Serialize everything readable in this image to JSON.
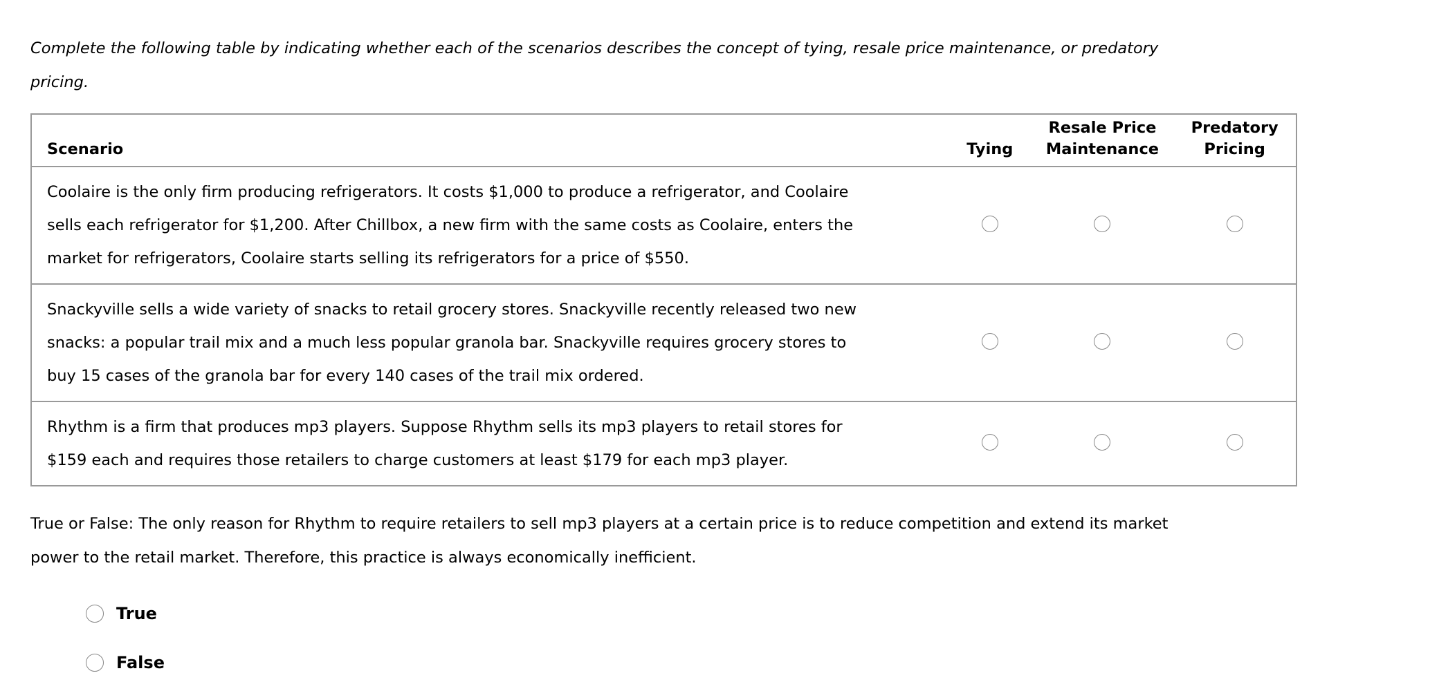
{
  "instructions": {
    "lines": [
      "Complete the following table by indicating whether each of the scenarios describes the concept of tying, resale price maintenance, or predatory",
      "pricing."
    ]
  },
  "table": {
    "headers": {
      "scenario": "Scenario",
      "tying": "Tying",
      "rpm_line1": "Resale Price",
      "rpm_line2": "Maintenance",
      "pred_line1": "Predatory",
      "pred_line2": "Pricing"
    },
    "rows": [
      {
        "lines": [
          "Coolaire is the only firm producing refrigerators. It costs $1,000 to produce a refrigerator, and Coolaire",
          "sells each refrigerator for $1,200. After Chillbox, a new firm with the same costs as Coolaire, enters the",
          "market for refrigerators, Coolaire starts selling its refrigerators for a price of $550."
        ],
        "selected": null
      },
      {
        "lines": [
          "Snackyville sells a wide variety of snacks to retail grocery stores. Snackyville recently released two new",
          "snacks: a popular trail mix and a much less popular granola bar. Snackyville requires grocery stores to",
          "buy 15 cases of the granola bar for every 140 cases of the trail mix ordered."
        ],
        "selected": null
      },
      {
        "lines": [
          "Rhythm is a firm that produces mp3 players. Suppose Rhythm sells its mp3 players to retail stores for",
          "$159 each and requires those retailers to charge customers at least $179 for each mp3 player."
        ],
        "selected": null
      }
    ]
  },
  "true_false": {
    "lines": [
      "True or False: The only reason for Rhythm to require retailers to sell mp3 players at a certain price is to reduce competition and extend its market",
      "power to the retail market. Therefore, this practice is always economically inefficient."
    ],
    "options": [
      "True",
      "False"
    ],
    "selected": null
  }
}
